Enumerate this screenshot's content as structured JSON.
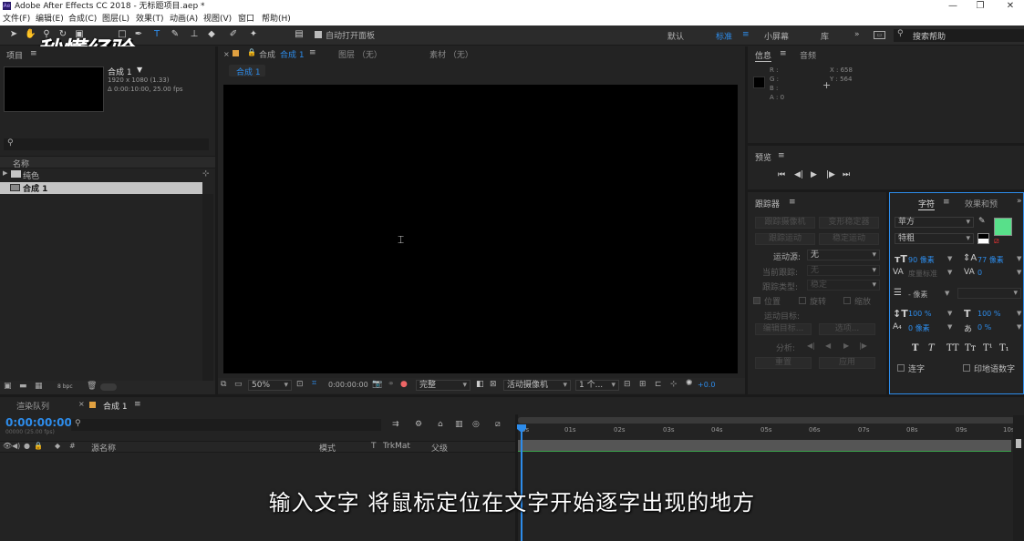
{
  "titlebar": {
    "icon": "Ae",
    "title": "Adobe After Effects CC 2018 - 无标题项目.aep *",
    "min": "—",
    "max": "❐",
    "close": "✕"
  },
  "menu": [
    "文件(F)",
    "编辑(E)",
    "合成(C)",
    "图层(L)",
    "效果(T)",
    "动画(A)",
    "视图(V)",
    "窗口",
    "帮助(H)"
  ],
  "toolbar": {
    "auto_open": "自动打开面板",
    "workspaces": [
      "默认",
      "标准",
      "小屏幕",
      "库"
    ],
    "active_workspace": "标准",
    "more": "»",
    "search_placeholder": "搜索帮助"
  },
  "watermark": "秒懂经验",
  "project": {
    "tab": "项目",
    "comp_name": "合成 1",
    "comp_res": "1920 x 1080 (1.33)",
    "comp_dur": "Δ 0:00:10:00, 25.00 fps",
    "col_name": "名称",
    "items": [
      "纯色",
      "合成 1"
    ],
    "bpc": "8 bpc"
  },
  "comp_panel": {
    "tab_comp_prefix": "合成",
    "tab_comp_name": "合成 1",
    "tab_layer": "图层 （无）",
    "tab_footage": "素材 （无）",
    "breadcrumb": "合成 1",
    "zoom": "50%",
    "timecode": "0:00:00:00",
    "quality": "完整",
    "camera": "活动摄像机",
    "views": "1 个...",
    "exposure": "+0.0"
  },
  "info": {
    "tab_info": "信息",
    "tab_audio": "音频",
    "r": "R :",
    "g": "G :",
    "b": "B :",
    "a": "A : 0",
    "x": "X : 658",
    "y": "Y : 564"
  },
  "preview": {
    "tab": "预览"
  },
  "tracker": {
    "tab": "跟踪器",
    "btn_track_camera": "跟踪摄像机",
    "btn_warp": "变形稳定器",
    "btn_track_motion": "跟踪运动",
    "btn_stabilize": "稳定运动",
    "source_label": "运动源:",
    "source_value": "无",
    "current_track_label": "当前跟踪:",
    "current_track_value": "无",
    "track_type_label": "跟踪类型:",
    "track_type_value": "稳定",
    "position": "位置",
    "rotation": "旋转",
    "scale": "缩放",
    "motion_target": "运动目标:",
    "edit_target": "编辑目标...",
    "options": "选项...",
    "analyze": "分析:",
    "reset": "重置",
    "apply": "应用"
  },
  "character": {
    "tab": "字符",
    "tab_effects": "效果和预",
    "font": "苹方",
    "style": "特粗",
    "size": "90 像素",
    "leading": "77 像素",
    "kerning": "度量标准",
    "tracking": "0",
    "stroke_width": "- 像素",
    "v_scale": "100 %",
    "h_scale": "100 %",
    "baseline": "0 像素",
    "tsume": "0 %",
    "ligatures": "连字",
    "hindi_digits": "印地语数字",
    "fill_color": "#58e08a",
    "styles": [
      "T",
      "T",
      "TT",
      "Tт",
      "T¹",
      "T₁"
    ]
  },
  "timeline": {
    "tab_render": "渲染队列",
    "tab_comp": "合成 1",
    "timecode": "0:00:00:00",
    "timecode_sub": "00000 (25.00 fps)",
    "col_source": "源名称",
    "col_mode": "模式",
    "col_t": "T",
    "col_trkmat": "TrkMat",
    "col_parent": "父级",
    "ticks": [
      "0s",
      "01s",
      "02s",
      "03s",
      "04s",
      "05s",
      "06s",
      "07s",
      "08s",
      "09s",
      "10s"
    ]
  },
  "subtitle": "输入文字  将鼠标定位在文字开始逐字出现的地方"
}
